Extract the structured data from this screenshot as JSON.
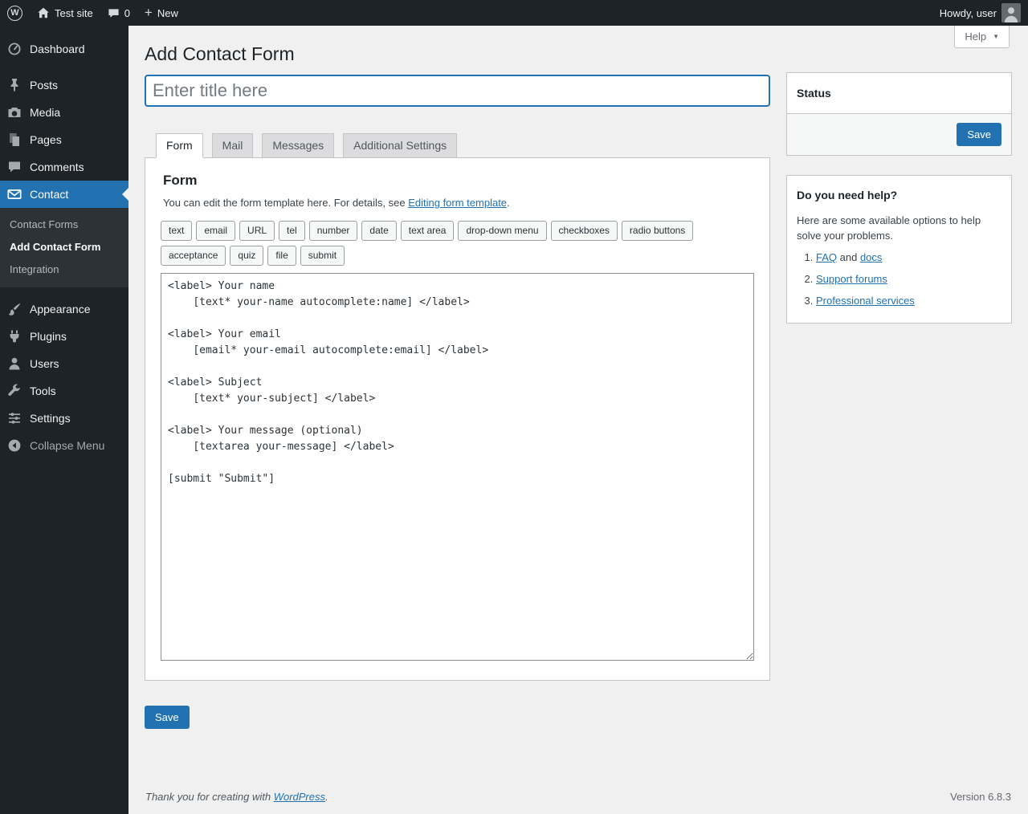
{
  "theme": {
    "accent": "#2271b1",
    "admin_bar_bg": "#1d2327",
    "sidebar_bg": "#1d2327",
    "submenu_bg": "#2c3338",
    "content_bg": "#f0f0f1",
    "panel_border": "#c3c4c7",
    "active_menu_bg": "#2271b1"
  },
  "admin_bar": {
    "logo_icon": "wordpress-logo-icon",
    "site_name": "Test site",
    "comments_icon": "comment-bubble-icon",
    "comments_count": "0",
    "new_icon": "plus-icon",
    "new_label": "New",
    "howdy": "Howdy, user",
    "avatar_icon": "user-avatar"
  },
  "sidebar": {
    "items": [
      {
        "label": "Dashboard",
        "icon": "dashboard-icon"
      },
      {
        "label": "Posts",
        "icon": "pushpin-icon"
      },
      {
        "label": "Media",
        "icon": "camera-icon"
      },
      {
        "label": "Pages",
        "icon": "pages-icon"
      },
      {
        "label": "Comments",
        "icon": "comments-icon"
      },
      {
        "label": "Contact",
        "icon": "mail-icon",
        "active": true
      },
      {
        "label": "Appearance",
        "icon": "brush-icon"
      },
      {
        "label": "Plugins",
        "icon": "plugin-icon"
      },
      {
        "label": "Users",
        "icon": "users-icon"
      },
      {
        "label": "Tools",
        "icon": "wrench-icon"
      },
      {
        "label": "Settings",
        "icon": "settings-icon"
      },
      {
        "label": "Collapse Menu",
        "icon": "collapse-arrow-icon"
      }
    ],
    "contact_submenu": [
      {
        "label": "Contact Forms"
      },
      {
        "label": "Add Contact Form",
        "current": true
      },
      {
        "label": "Integration"
      }
    ]
  },
  "header": {
    "page_title": "Add Contact Form",
    "help_label": "Help",
    "help_caret_icon": "chevron-down-icon"
  },
  "title_input": {
    "value": "",
    "placeholder": "Enter title here"
  },
  "tabs": [
    {
      "label": "Form",
      "active": true
    },
    {
      "label": "Mail",
      "active": false
    },
    {
      "label": "Messages",
      "active": false
    },
    {
      "label": "Additional Settings",
      "active": false
    }
  ],
  "form_panel": {
    "heading": "Form",
    "description_prefix": "You can edit the form template here. For details, see ",
    "description_link": "Editing form template",
    "description_suffix": ".",
    "tag_buttons": [
      "text",
      "email",
      "URL",
      "tel",
      "number",
      "date",
      "text area",
      "drop-down menu",
      "checkboxes",
      "radio buttons",
      "acceptance",
      "quiz",
      "file",
      "submit"
    ],
    "template": "<label> Your name\n    [text* your-name autocomplete:name] </label>\n\n<label> Your email\n    [email* your-email autocomplete:email] </label>\n\n<label> Subject\n    [text* your-subject] </label>\n\n<label> Your message (optional)\n    [textarea your-message] </label>\n\n[submit \"Submit\"]"
  },
  "actions": {
    "save_label": "Save"
  },
  "status_box": {
    "title": "Status",
    "save_label": "Save"
  },
  "help_box": {
    "title": "Do you need help?",
    "intro": "Here are some available options to help solve your problems.",
    "items": [
      {
        "link1": "FAQ",
        "mid": " and ",
        "link2": "docs"
      },
      {
        "link": "Support forums"
      },
      {
        "link": "Professional services"
      }
    ]
  },
  "footer": {
    "thanks_prefix": "Thank you for creating with ",
    "thanks_link": "WordPress",
    "thanks_suffix": ".",
    "version": "Version 6.8.3"
  }
}
